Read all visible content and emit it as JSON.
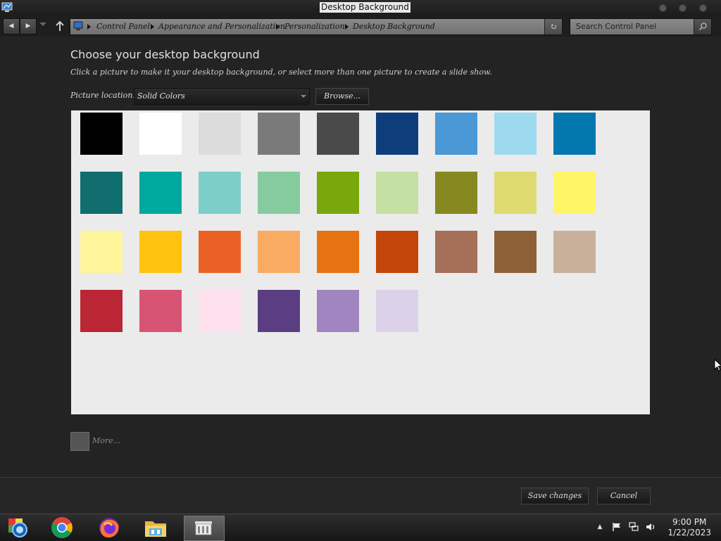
{
  "window": {
    "title": "Desktop Background"
  },
  "address_bar": {
    "crumbs": [
      "Control Panel",
      "Appearance and Personalization",
      "Personalization",
      "Desktop Background"
    ]
  },
  "search": {
    "placeholder": "Search Control Panel"
  },
  "page": {
    "heading": "Choose your desktop background",
    "subtext": "Click a picture to make it your desktop background, or select more than one picture to create a slide show.",
    "location_label": "Picture location:",
    "location_value": "Solid Colors",
    "browse_label": "Browse..."
  },
  "swatches": [
    "#000000",
    "#ffffff",
    "#dcdcdc",
    "#7a7a7a",
    "#4a4a4a",
    "#0e3d7c",
    "#4a98d6",
    "#9ddaf0",
    "#0378ae",
    "#106e6e",
    "#00a99d",
    "#7dcdc8",
    "#85cb9e",
    "#78a80c",
    "#c5e0a3",
    "#858920",
    "#dedb70",
    "#fff566",
    "#fff59b",
    "#ffc20f",
    "#eb6125",
    "#f9ab61",
    "#e77211",
    "#c4460b",
    "#a56f58",
    "#8e6038",
    "#c8b09b",
    "#ba2633",
    "#d85474",
    "#fde0ec",
    "#5b3d83",
    "#a185c0",
    "#dbd1e9"
  ],
  "more": {
    "label": "More..."
  },
  "footer": {
    "save_label": "Save changes",
    "cancel_label": "Cancel"
  },
  "taskbar": {
    "apps": [
      "color-settings-icon",
      "chrome-icon",
      "firefox-icon",
      "file-explorer-icon",
      "control-panel-icon"
    ],
    "time": "9:00 PM",
    "date": "1/22/2023"
  }
}
